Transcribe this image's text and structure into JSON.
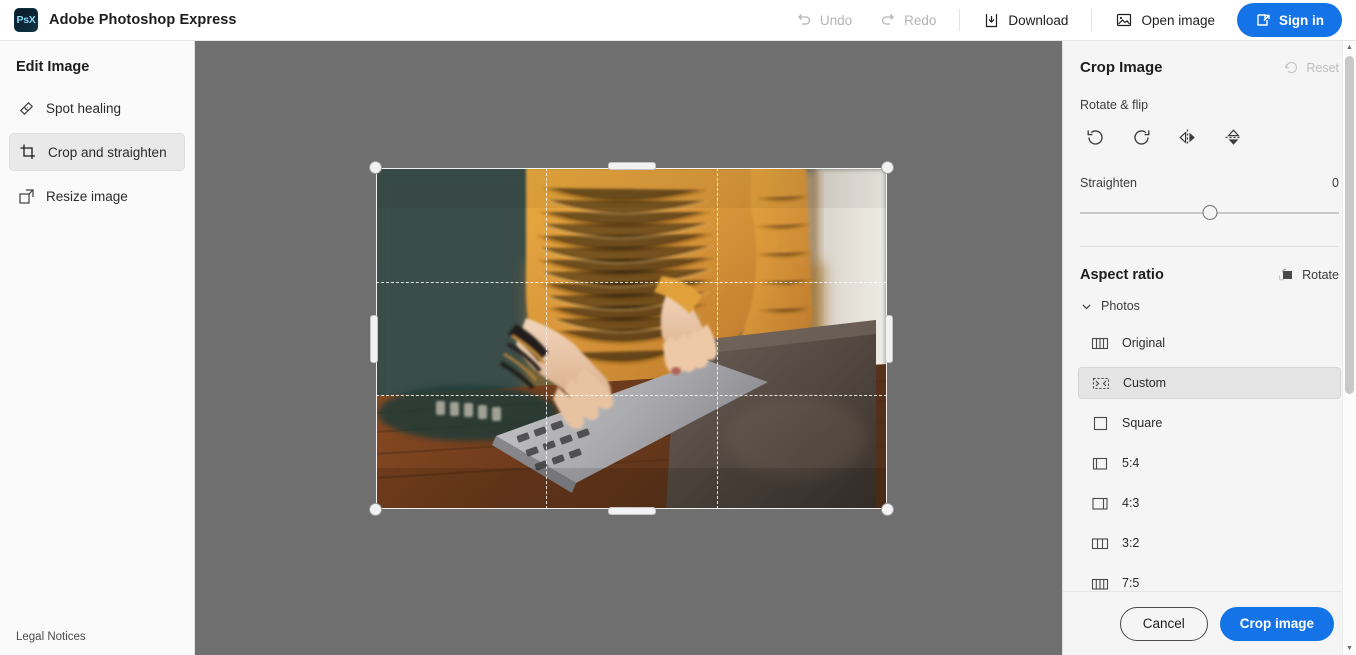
{
  "app": {
    "brand_logo_text": "PsX",
    "brand_name": "Adobe Photoshop Express"
  },
  "topbar": {
    "undo_label": "Undo",
    "redo_label": "Redo",
    "download_label": "Download",
    "open_image_label": "Open image",
    "signin_label": "Sign in",
    "accent_color": "#1473e6"
  },
  "sidebar": {
    "title": "Edit Image",
    "items": [
      {
        "label": "Spot healing",
        "icon": "bandage-icon",
        "active": false
      },
      {
        "label": "Crop and straighten",
        "icon": "crop-icon",
        "active": true
      },
      {
        "label": "Resize image",
        "icon": "resize-icon",
        "active": false
      }
    ],
    "legal_label": "Legal Notices"
  },
  "canvas": {
    "background_color": "#706f6f",
    "crop_overlay": {
      "grid": "rule-of-thirds",
      "corner_handles": 4,
      "edge_handles": 4
    }
  },
  "crop_panel": {
    "title": "Crop Image",
    "reset_label": "Reset",
    "reset_enabled": false,
    "rotate_flip_label": "Rotate & flip",
    "rotate_flip_buttons": [
      "rotate-counterclockwise-icon",
      "rotate-clockwise-icon",
      "flip-horizontal-icon",
      "flip-vertical-icon"
    ],
    "straighten_label": "Straighten",
    "straighten_value": "0",
    "aspect_ratio_label": "Aspect ratio",
    "rotate_button_label": "Rotate",
    "group_label": "Photos",
    "group_expanded": true,
    "ratios": [
      {
        "label": "Original",
        "icon": "ratio-original-icon",
        "selected": false
      },
      {
        "label": "Custom",
        "icon": "ratio-custom-icon",
        "selected": true
      },
      {
        "label": "Square",
        "icon": "ratio-square-icon",
        "selected": false
      },
      {
        "label": "5:4",
        "icon": "ratio-5-4-icon",
        "selected": false
      },
      {
        "label": "4:3",
        "icon": "ratio-4-3-icon",
        "selected": false
      },
      {
        "label": "3:2",
        "icon": "ratio-3-2-icon",
        "selected": false
      },
      {
        "label": "7:5",
        "icon": "ratio-7-5-icon",
        "selected": false
      }
    ],
    "cancel_label": "Cancel",
    "crop_label": "Crop image"
  }
}
